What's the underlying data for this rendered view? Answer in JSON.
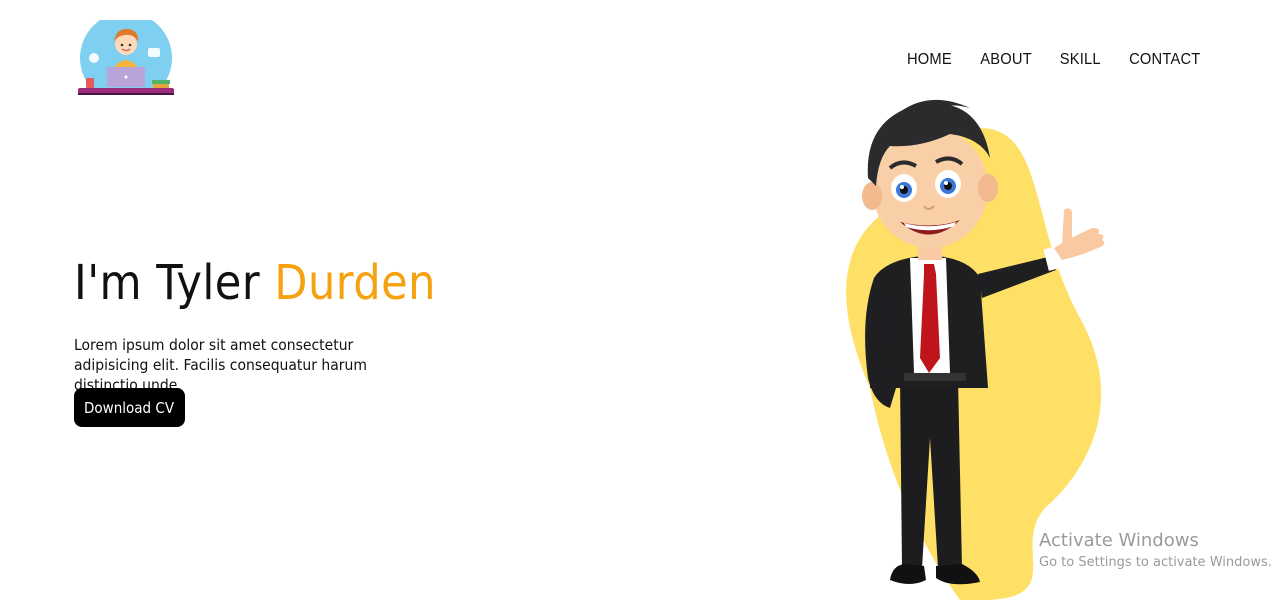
{
  "header": {
    "logo": {
      "icon": "developer-at-laptop-logo-icon"
    },
    "nav": {
      "items": [
        {
          "label": "HOME"
        },
        {
          "label": "ABOUT"
        },
        {
          "label": "SKILL"
        },
        {
          "label": "CONTACT"
        }
      ]
    }
  },
  "hero": {
    "title_prefix": "I'm Tyler ",
    "title_highlight": "Durden",
    "description": "Lorem ipsum dolor sit amet consectetur adipisicing elit. Facilis consequatur harum distinctio unde,",
    "cta_label": "Download CV",
    "illustration": {
      "icon": "businessman-cartoon-waving-icon"
    }
  },
  "watermark": {
    "title": "Activate Windows",
    "subtitle": "Go to Settings to activate Windows."
  },
  "colors": {
    "accent": "#f6a210",
    "blob": "#ffe066",
    "button": "#000000",
    "text": "#111111"
  }
}
